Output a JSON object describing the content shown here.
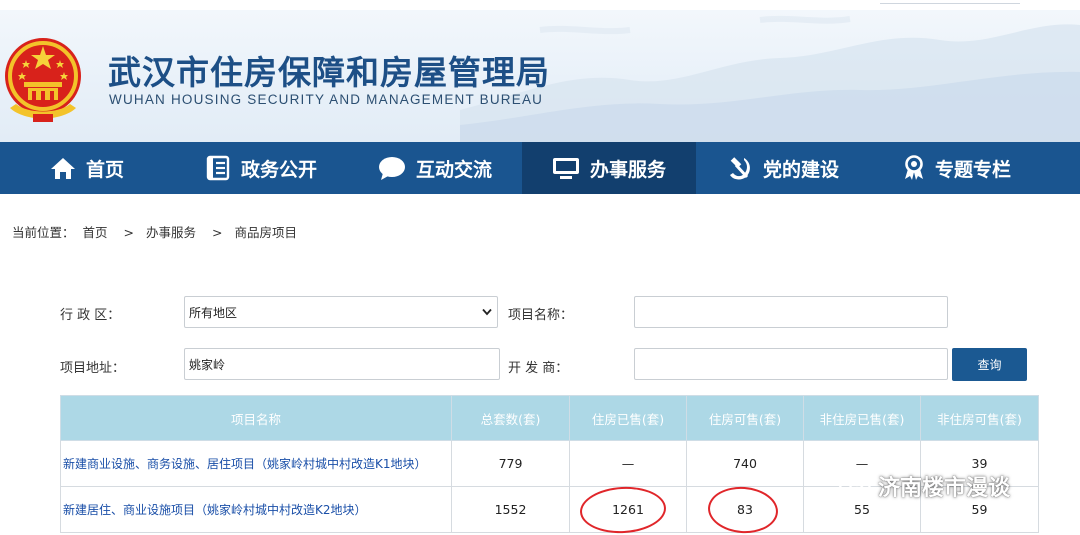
{
  "header": {
    "title_cn": "武汉市住房保障和房屋管理局",
    "title_en": "WUHAN HOUSING SECURITY AND MANAGEMENT BUREAU"
  },
  "nav": {
    "items": [
      {
        "label": "首页",
        "icon": "home-icon"
      },
      {
        "label": "政务公开",
        "icon": "document-icon"
      },
      {
        "label": "互动交流",
        "icon": "chat-bubble-icon"
      },
      {
        "label": "办事服务",
        "icon": "monitor-icon"
      },
      {
        "label": "党的建设",
        "icon": "hammer-sickle-icon"
      },
      {
        "label": "专题专栏",
        "icon": "ribbon-award-icon"
      }
    ],
    "active_index": 3
  },
  "breadcrumb": {
    "prefix": "当前位置：",
    "items": [
      "首页",
      "办事服务",
      "商品房项目"
    ],
    "separator": ">"
  },
  "search": {
    "district_label": "行 政 区：",
    "district_value": "所有地区",
    "project_name_label": "项目名称：",
    "project_name_value": "",
    "address_label": "项目地址：",
    "address_value": "姚家岭",
    "developer_label": "开 发 商：",
    "developer_value": "",
    "query_button": "查询"
  },
  "table": {
    "headers": [
      "项目名称",
      "总套数(套)",
      "住房已售(套)",
      "住房可售(套)",
      "非住房已售(套)",
      "非住房可售(套)"
    ],
    "rows": [
      [
        "新建商业设施、商务设施、居住项目（姚家岭村城中村改造K1地块）",
        "779",
        "—",
        "740",
        "—",
        "39"
      ],
      [
        "新建居住、商业设施项目（姚家岭村城中村改造K2地块）",
        "1552",
        "1261",
        "83",
        "55",
        "59"
      ]
    ]
  },
  "watermark": {
    "text": "济南楼市漫谈",
    "icon": "wechat-icon"
  },
  "colors": {
    "nav_bg": "#1a5590",
    "nav_active_bg": "#123f6e",
    "title": "#1d4f86",
    "table_header_bg": "#add8e6",
    "link": "#1a4fa8",
    "highlight_circle": "#e0262a",
    "button_bg": "#1b5992"
  }
}
